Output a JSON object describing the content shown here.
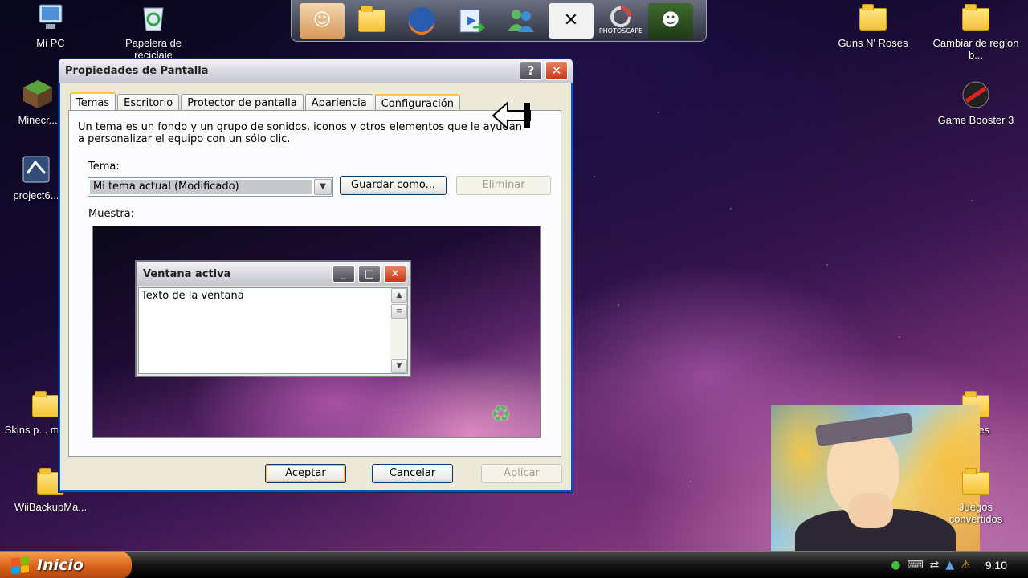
{
  "desktop": {
    "icons_left": [
      {
        "label": "Mi PC",
        "icon": "computer-icon"
      },
      {
        "label": "Papelera de reciclaje",
        "icon": "recycle-bin-icon"
      },
      {
        "label": "Minecr...",
        "icon": "minecraft-icon"
      },
      {
        "label": "project6...",
        "icon": "app-icon"
      },
      {
        "label": "Skins p... minec...",
        "icon": "folder-icon"
      },
      {
        "label": "WiiBackupMa...",
        "icon": "folder-icon"
      }
    ],
    "icons_right": [
      {
        "label": "Guns N' Roses",
        "icon": "folder-icon"
      },
      {
        "label": "Cambiar de region b...",
        "icon": "folder-icon"
      },
      {
        "label": "Game Booster 3",
        "icon": "game-booster-icon"
      },
      {
        "label": "saves",
        "icon": "folder-icon"
      },
      {
        "label": "Juegos convertidos",
        "icon": "folder-icon"
      }
    ]
  },
  "dock": {
    "items": [
      "anime-avatar-icon",
      "folder-icon",
      "firefox-icon",
      "media-icon",
      "messenger-icon",
      "xfire-icon",
      "photoscape-icon",
      "ogre-icon"
    ],
    "photoscape_label": "PHOTOSCAPE"
  },
  "dialog": {
    "title": "Propiedades de Pantalla",
    "help_label": "?",
    "close_label": "✕",
    "tabs": [
      {
        "label": "Temas",
        "active": true
      },
      {
        "label": "Escritorio",
        "active": false
      },
      {
        "label": "Protector de pantalla",
        "active": false
      },
      {
        "label": "Apariencia",
        "active": false
      },
      {
        "label": "Configuración",
        "active": false
      }
    ],
    "description": "Un tema es un fondo y un grupo de sonidos, iconos y otros elementos que le ayudan a personalizar el equipo con un sólo clic.",
    "theme_label": "Tema:",
    "theme_value": "Mi tema actual (Modificado)",
    "save_as_label": "Guardar como...",
    "delete_label": "Eliminar",
    "sample_label": "Muestra:",
    "preview": {
      "window_title": "Ventana activa",
      "window_text": "Texto de la ventana"
    },
    "buttons": {
      "ok": "Aceptar",
      "cancel": "Cancelar",
      "apply": "Aplicar"
    }
  },
  "taskbar": {
    "start_label": "Inicio",
    "clock": "9:10",
    "tray_icons": [
      "keyboard-icon",
      "network-icon",
      "antivirus-icon",
      "warning-icon",
      "utorrent-icon"
    ]
  },
  "colors": {
    "start_button": "#d9621a",
    "dialog_bg": "#ece9d8",
    "tab_highlight": "#ffc83c",
    "close_red": "#c33a1a"
  }
}
